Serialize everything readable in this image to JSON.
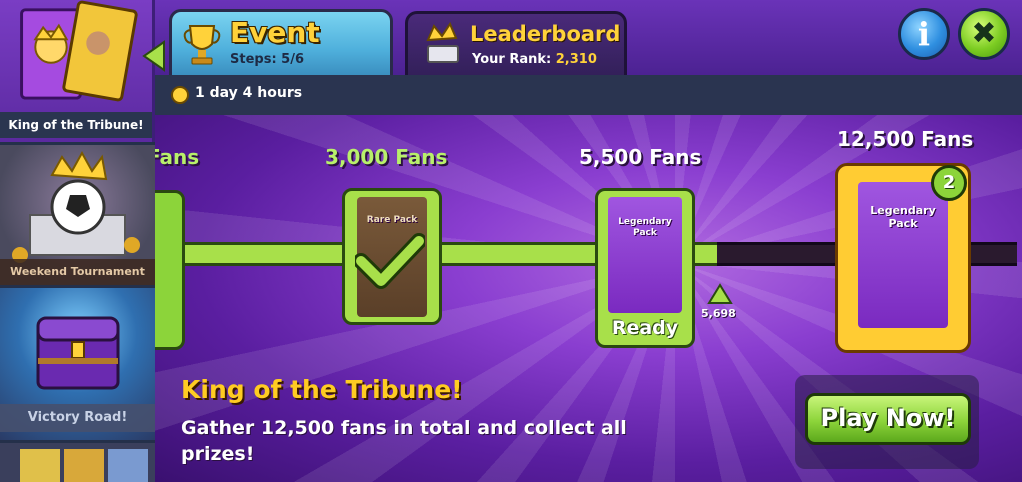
{
  "sidebar": {
    "items": [
      {
        "label": "King of the Tribune!",
        "selected": true
      },
      {
        "label": "Weekend Tournament",
        "selected": false
      },
      {
        "label": "Victory Road!",
        "selected": false
      },
      {
        "label": "",
        "selected": false
      }
    ]
  },
  "tabs": {
    "event": {
      "title": "Event",
      "steps_label": "Steps:",
      "steps_value": "5/6"
    },
    "leaderboard": {
      "title": "Leaderboard",
      "rank_label": "Your Rank:",
      "rank_value": "2,310"
    }
  },
  "header_buttons": {
    "info_icon": "info-icon",
    "close_icon": "close-icon",
    "info_glyph": "i",
    "close_glyph": "✖"
  },
  "timer": {
    "text": "1 day 4 hours"
  },
  "track": {
    "milestones": [
      {
        "fans": "Fans",
        "state": "claimed"
      },
      {
        "fans": "3,000 Fans",
        "pack": "Rare Pack",
        "state": "claimed"
      },
      {
        "fans": "5,500 Fans",
        "pack": "Legendary Pack",
        "state": "ready",
        "status_label": "Ready"
      },
      {
        "fans": "12,500 Fans",
        "pack": "Legendary Pack",
        "state": "locked",
        "count": "2"
      }
    ],
    "current_fans": "5,698",
    "progress_fraction": 0.4558
  },
  "event_info": {
    "title": "King of the Tribune!",
    "description": "Gather 12,500 fans in total and collect all prizes!"
  },
  "play_button": {
    "label": "Play Now!"
  },
  "colors": {
    "accent_green": "#8cd43a",
    "gold": "#ffcc22",
    "purple": "#7a2ac0",
    "blue": "#4fb0dc"
  }
}
